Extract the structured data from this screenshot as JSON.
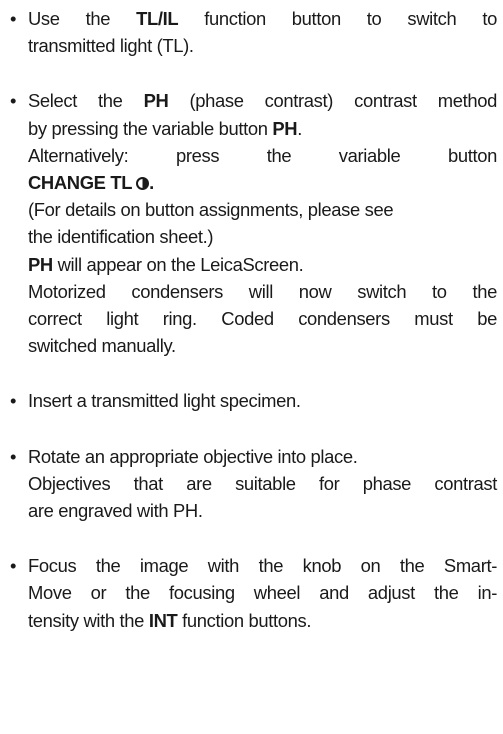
{
  "bullet": "•",
  "items": [
    {
      "p1": "Use the ",
      "b1": "TL/IL",
      "p2": " function button to switch to",
      "line2": "transmitted light (TL)."
    },
    {
      "l1a": "Select the ",
      "l1b": "PH",
      "l1c": " (phase contrast) contrast method",
      "l2a": "by pressing the variable button ",
      "l2b": "PH",
      "l2c": ".",
      "l3": "Alternatively: press the variable button",
      "l4b": "CHANGE TL",
      "l4c": ".",
      "l5": "(For details on button assignments, please see",
      "l6": "the identification sheet.)",
      "l7b": "PH",
      "l7c": " will appear on the LeicaScreen.",
      "l8": "Motorized condensers will now switch to the",
      "l9": "correct light ring. Coded condensers must be",
      "l10": "switched manually."
    },
    {
      "l1": "Insert a transmitted light specimen."
    },
    {
      "l1": "Rotate an appropriate objective into place.",
      "l2": "Objectives that are suitable for phase contrast",
      "l3": "are engraved with PH."
    },
    {
      "l1": "Focus the image with the knob on the Smart-",
      "l2": "Move or the focusing wheel and adjust the in-",
      "l3a": "tensity with the ",
      "l3b": "INT",
      "l3c": " function buttons."
    }
  ],
  "icons": {
    "contrast_icon": "half-filled-circle"
  }
}
